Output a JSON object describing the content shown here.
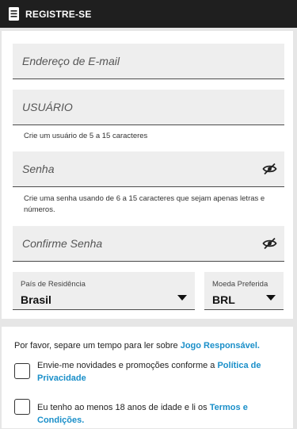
{
  "header": {
    "title": "REGISTRE-SE",
    "icon": "document-icon"
  },
  "form": {
    "email_placeholder": "Endereço de E-mail",
    "username_placeholder": "USUÁRIO",
    "username_hint": "Crie um usuário de 5 a 15 caracteres",
    "password_placeholder": "Senha",
    "password_hint_line1": "Crie uma senha usando de 6 a 15 caracteres que sejam apenas letras e",
    "password_hint_line2": "números.",
    "confirm_password_placeholder": "Confirme Senha",
    "country_label": "País de Residência",
    "country_value": "Brasil",
    "currency_label": "Moeda Preferida",
    "currency_value": "BRL"
  },
  "terms": {
    "intro_text": "Por favor, separe um tempo para ler sobre ",
    "intro_link": "Jogo Responsável.",
    "newsletter_text": "Envie-me novidades e promoções conforme a ",
    "newsletter_link_1": "Política de",
    "newsletter_link_2": "Privacidade",
    "age_text": "Eu tenho ao menos 18 anos de idade e li os ",
    "age_link": "Termos e Condições."
  },
  "colors": {
    "header_bg": "#1f1f1f",
    "link": "#1a8fc9",
    "field_bg": "#eeeeee"
  }
}
